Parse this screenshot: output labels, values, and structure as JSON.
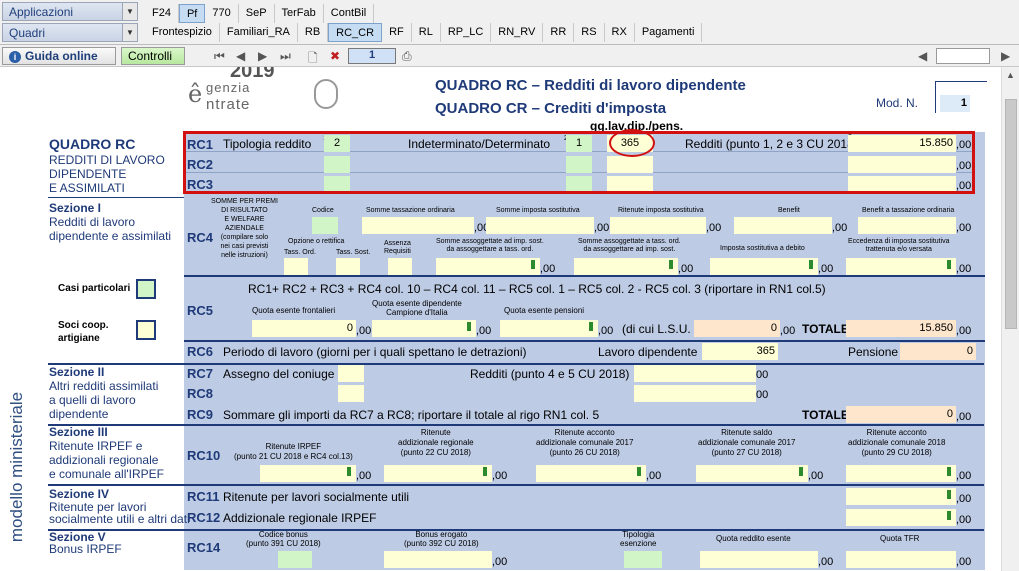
{
  "top": {
    "applicazioni": "Applicazioni",
    "quadri": "Quadri",
    "tabs1": [
      "F24",
      "Pf",
      "770",
      "SeP",
      "TerFab",
      "ContBil"
    ],
    "tabs2": [
      "Frontespizio",
      "Familiari_RA",
      "RB",
      "RC_CR",
      "RF",
      "RL",
      "RP_LC",
      "RN_RV",
      "RR",
      "RS",
      "RX",
      "Pagamenti"
    ]
  },
  "toolbar": {
    "guida": "Guida online",
    "controlli": "Controlli",
    "page": "1"
  },
  "header": {
    "year": "2019",
    "logo1": "genzia",
    "logo2": "ntrate",
    "title_rc_bold": "QUADRO RC",
    "title_rc_rest": " – Redditi di lavoro dipendente",
    "title_cr_bold": "QUADRO CR",
    "title_cr_rest": " – Crediti d'imposta",
    "modn": "Mod. N.",
    "modn_val": "1",
    "marker": "gg.lav.dip./pens."
  },
  "left": {
    "qrc": "QUADRO RC",
    "qrc_sub": [
      "REDDITI DI LAVORO",
      "DIPENDENTE",
      "E ASSIMILATI"
    ],
    "sec1": "Sezione I",
    "sec1_sub": [
      "Redditi di lavoro",
      "dipendente e assimilati"
    ],
    "casi": "Casi particolari",
    "soci": [
      "Soci coop.",
      "artigiane"
    ],
    "sec2": "Sezione II",
    "sec2_sub": [
      "Altri redditi assimilati",
      "a quelli di lavoro",
      "dipendente"
    ],
    "sec3": "Sezione III",
    "sec3_sub": [
      "Ritenute IRPEF e",
      "addizionali regionale",
      "e comunale all'IRPEF"
    ],
    "sec4": "Sezione IV",
    "sec4_sub": [
      "Ritenute per lavori",
      "socialmente utili e altri dati"
    ],
    "sec5": "Sezione V",
    "sec5_sub": [
      "Bonus IRPEF"
    ],
    "vertical": "modello ministeriale"
  },
  "rc1": {
    "code": "RC1",
    "tipologia": "Tipologia reddito",
    "tip_val": "2",
    "indet": "Indeterminato/Determinato",
    "ind_val": "1",
    "gg": "365",
    "redditi": "Redditi (punto 1, 2 e 3 CU 2018)",
    "red_val": "15.850",
    "dec": ",00"
  },
  "rc2": {
    "code": "RC2",
    "dec": ",00"
  },
  "rc3": {
    "code": "RC3",
    "dec": ",00"
  },
  "rc4": {
    "code": "RC4",
    "somme_premi": [
      "SOMME PER PREMI",
      "DI RISULTATO",
      "E WELFARE",
      "AZIENDALE",
      "(compilare solo",
      "nei casi previsti",
      "nelle istruzioni)"
    ],
    "codice": "Codice",
    "h2": "Somme tassazione ordinaria",
    "h3": "Somme imposta sostitutiva",
    "h4": "Ritenute imposta sostitutiva",
    "h5": "Benefit",
    "h6": "Benefit a tassazione ordinaria",
    "opzione": "Opzione o rettifica",
    "tassord": "Tass. Ord.",
    "tasssost": "Tass. Sost.",
    "assenza": [
      "Assenza",
      "Requisiti"
    ],
    "h10": [
      "Somme assoggettate ad imp. sost.",
      "da assoggettare a tass. ord."
    ],
    "h11": [
      "Somme assoggettate a tass. ord.",
      "da assoggettare ad imp. sost."
    ],
    "h12": "Imposta sostitutiva a debito",
    "h13": [
      "Eccedenza di imposta sostitutiva",
      "trattenuta e/o versata"
    ],
    "dec": ",00"
  },
  "rc5": {
    "code": "RC5",
    "formula": "RC1+ RC2 + RC3 + RC4 col. 10 – RC4 col. 11 – RC5 col. 1 – RC5 col. 2 - RC5 col. 3 (riportare in RN1 col.5)",
    "frontalieri": "Quota esente frontalieri",
    "campione": [
      "Quota esente dipendente",
      "Campione d'Italia"
    ],
    "pensioni": "Quota esente pensioni",
    "lsu": "(di cui L.S.U.",
    "v1": "0",
    "v4": "0",
    "totale": "TOTALE",
    "tot_val": "15.850",
    "dec": ",00"
  },
  "rc6": {
    "code": "RC6",
    "label": "Periodo di lavoro (giorni per i quali spettano le detrazioni)",
    "dip": "Lavoro dipendente",
    "dip_val": "365",
    "pens": "Pensione",
    "pens_val": "0"
  },
  "rc7": {
    "code": "RC7",
    "label": "Assegno del coniuge",
    "redditi": "Redditi  (punto 4 e 5 CU 2018)",
    "dec": "00"
  },
  "rc8": {
    "code": "RC8",
    "dec": "00"
  },
  "rc9": {
    "code": "RC9",
    "label": "Sommare gli importi da RC7 a RC8; riportare il totale al rigo RN1 col. 5",
    "totale": "TOTALE",
    "val": "0",
    "dec": ",00"
  },
  "rc10": {
    "code": "RC10",
    "h1": [
      "Ritenute IRPEF",
      "(punto 21 CU 2018 e RC4 col.13)"
    ],
    "h2": [
      "Ritenute",
      "addizionale regionale",
      "(punto 22 CU 2018)"
    ],
    "h3": [
      "Ritenute acconto",
      "addizionale comunale 2017",
      "(punto 26 CU 2018)"
    ],
    "h4": [
      "Ritenute saldo",
      "addizionale comunale 2017",
      "(punto 27 CU 2018)"
    ],
    "h5": [
      "Ritenute acconto",
      "addizionale comunale 2018",
      "(punto 29 CU 2018)"
    ],
    "dec": ",00"
  },
  "rc11": {
    "code": "RC11",
    "label": "Ritenute per lavori socialmente utili",
    "dec": ",00"
  },
  "rc12": {
    "code": "RC12",
    "label": "Addizionale regionale IRPEF",
    "dec": ",00"
  },
  "rc14": {
    "code": "RC14",
    "h1": [
      "Codice bonus",
      "(punto 391 CU 2018)"
    ],
    "h2": [
      "Bonus erogato",
      "(punto 392 CU 2018)"
    ],
    "h3": [
      "Tipologia",
      "esenzione"
    ],
    "h4": "Quota reddito esente",
    "h5": "Quota TFR",
    "dec": ",00"
  }
}
